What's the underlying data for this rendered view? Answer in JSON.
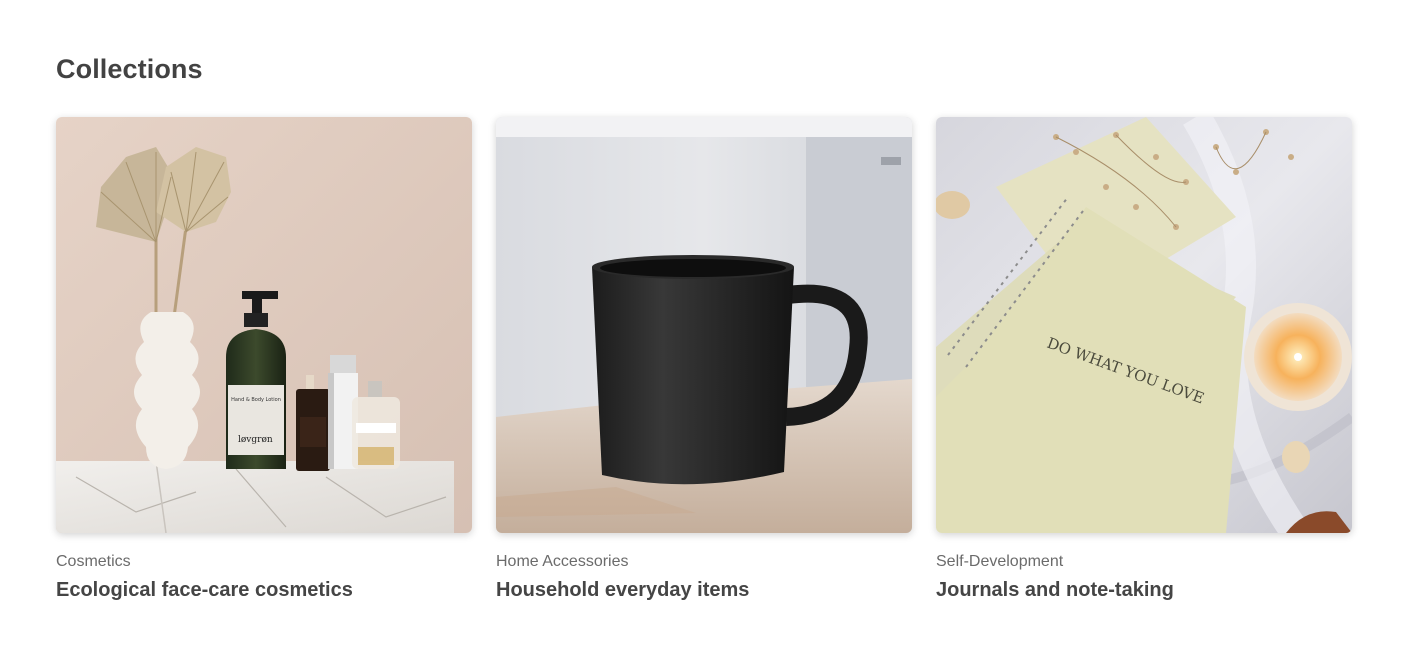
{
  "section": {
    "title": "Collections"
  },
  "cards": [
    {
      "category": "Cosmetics",
      "title": "Ecological face-care cosmetics",
      "image_alt": "Cosmetics bottles with a vase and dried palm leaves",
      "image_labels": {
        "lotion": "Hand & Body Lotion",
        "brand": "løvgrøn"
      }
    },
    {
      "category": "Home Accessories",
      "title": "Household everyday items",
      "image_alt": "Black ceramic mug on a wooden table"
    },
    {
      "category": "Self-Development",
      "title": "Journals and note-taking",
      "image_alt": "Spiral notebooks with dried flowers and a candle",
      "image_labels": {
        "notebook": "DO WHAT YOU LOVE"
      }
    }
  ]
}
